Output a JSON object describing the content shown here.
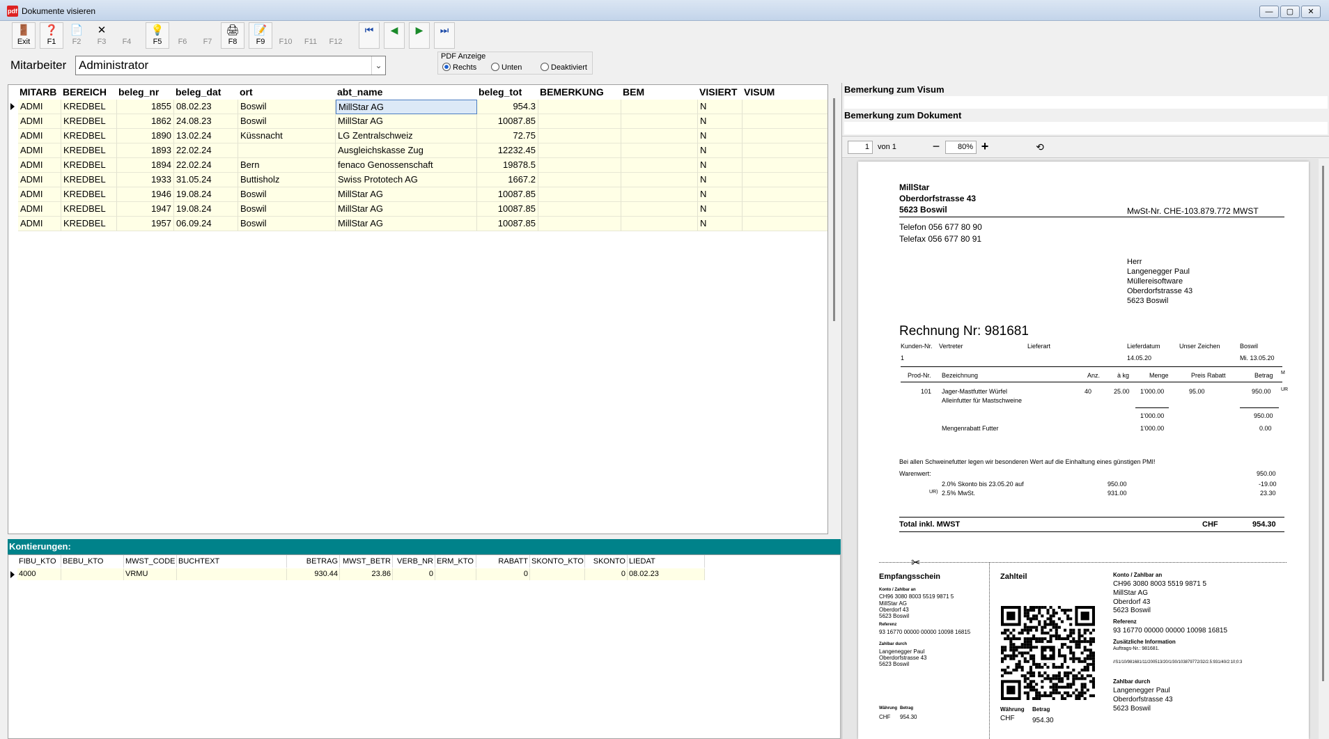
{
  "window": {
    "title": "Dokumente visieren",
    "app_icon": "pdf",
    "min": "—",
    "max": "▢",
    "close": "✕"
  },
  "toolbar": [
    {
      "label": "Exit",
      "icon": "exit-door-icon",
      "glyph": "🚪",
      "enabled": true
    },
    {
      "label": "F1",
      "icon": "help-icon",
      "glyph": "❓",
      "enabled": true
    },
    {
      "label": "F2",
      "icon": "new-document-icon",
      "glyph": "📄",
      "enabled": false
    },
    {
      "label": "F3",
      "icon": "delete-icon",
      "glyph": "✕",
      "enabled": false
    },
    {
      "label": "F4",
      "icon": "",
      "glyph": "",
      "enabled": false
    },
    {
      "label": "F5",
      "icon": "lightbulb-icon",
      "glyph": "💡",
      "enabled": true
    },
    {
      "label": "F6",
      "icon": "",
      "glyph": "",
      "enabled": false
    },
    {
      "label": "F7",
      "icon": "",
      "glyph": "",
      "enabled": false
    },
    {
      "label": "F8",
      "icon": "print-icon",
      "glyph": "🖨",
      "enabled": true
    },
    {
      "label": "F9",
      "icon": "edit-icon",
      "glyph": "📝",
      "enabled": true
    },
    {
      "label": "F10",
      "icon": "",
      "glyph": "",
      "enabled": false
    },
    {
      "label": "F11",
      "icon": "",
      "glyph": "",
      "enabled": false
    },
    {
      "label": "F12",
      "icon": "",
      "glyph": "",
      "enabled": false
    }
  ],
  "nav_buttons": [
    {
      "icon": "first-record-icon",
      "glyph": "⏮",
      "color": "#1b4aa8"
    },
    {
      "icon": "previous-record-icon",
      "glyph": "◀",
      "color": "#1a8a2a"
    },
    {
      "icon": "next-record-icon",
      "glyph": "▶",
      "color": "#1a8a2a"
    },
    {
      "icon": "last-record-icon",
      "glyph": "⏭",
      "color": "#1b4aa8"
    }
  ],
  "filter": {
    "label": "Mitarbeiter",
    "value": "Administrator",
    "arrow": "⌄"
  },
  "pdf_display": {
    "legend": "PDF Anzeige",
    "options": [
      "Rechts",
      "Unten",
      "Deaktiviert"
    ],
    "selected": "Rechts"
  },
  "grid": {
    "columns": [
      "MITARB",
      "BEREICH",
      "beleg_nr",
      "beleg_dat",
      "ort",
      "abt_name",
      "beleg_tot",
      "BEMERKUNG",
      "BEM",
      "VISIERT",
      "VISUM"
    ],
    "rows": [
      [
        "ADMI",
        "KREDBEL",
        "1855",
        "08.02.23",
        "Boswil",
        "MillStar AG",
        "954.3",
        "",
        "",
        "N",
        ""
      ],
      [
        "ADMI",
        "KREDBEL",
        "1862",
        "24.08.23",
        "Boswil",
        "MillStar AG",
        "10087.85",
        "",
        "",
        "N",
        ""
      ],
      [
        "ADMI",
        "KREDBEL",
        "1890",
        "13.02.24",
        "Küssnacht",
        "LG Zentralschweiz",
        "72.75",
        "",
        "",
        "N",
        ""
      ],
      [
        "ADMI",
        "KREDBEL",
        "1893",
        "22.02.24",
        "",
        "Ausgleichskasse Zug",
        "12232.45",
        "",
        "",
        "N",
        ""
      ],
      [
        "ADMI",
        "KREDBEL",
        "1894",
        "22.02.24",
        "Bern",
        "fenaco Genossenschaft",
        "19878.5",
        "",
        "",
        "N",
        ""
      ],
      [
        "ADMI",
        "KREDBEL",
        "1933",
        "31.05.24",
        "Buttisholz",
        "Swiss Prototech AG",
        "1667.2",
        "",
        "",
        "N",
        ""
      ],
      [
        "ADMI",
        "KREDBEL",
        "1946",
        "19.08.24",
        "Boswil",
        "MillStar AG",
        "10087.85",
        "",
        "",
        "N",
        ""
      ],
      [
        "ADMI",
        "KREDBEL",
        "1947",
        "19.08.24",
        "Boswil",
        "MillStar AG",
        "10087.85",
        "",
        "",
        "N",
        ""
      ],
      [
        "ADMI",
        "KREDBEL",
        "1957",
        "06.09.24",
        "Boswil",
        "MillStar AG",
        "10087.85",
        "",
        "",
        "N",
        ""
      ]
    ]
  },
  "kontierungen": {
    "label": "Kontierungen:",
    "columns": [
      "FIBU_KTO",
      "BEBU_KTO",
      "MWST_CODE",
      "BUCHTEXT",
      "BETRAG",
      "MWST_BETR",
      "VERB_NR",
      "ERM_KTO",
      "RABATT",
      "SKONTO_KTO",
      "SKONTO",
      "LIEDAT"
    ],
    "rows": [
      [
        "4000",
        "",
        "VRMU",
        "",
        "930.44",
        "23.86",
        "0",
        "",
        "0",
        "",
        "0",
        "08.02.23"
      ]
    ]
  },
  "right": {
    "bem_visum": "Bemerkung zum Visum",
    "bem_dokument": "Bemerkung zum Dokument"
  },
  "pdf_toolbar": {
    "page": "1",
    "of": "von 1",
    "zoom": "80%",
    "minus": "−",
    "plus": "+",
    "rotate": "⟲"
  },
  "invoice": {
    "sender": [
      "MillStar",
      "Oberdorfstrasse 43",
      "5623  Boswil"
    ],
    "vat": "MwSt-Nr. CHE-103.879.772 MWST",
    "tel": "Telefon  056 677 80 90",
    "fax": "Telefax  056 677 80 91",
    "recipient": [
      "Herr",
      "Langenegger Paul",
      "Müllereisoftware",
      "Oberdorfstrasse 43",
      "5623 Boswil"
    ],
    "title": "Rechnung Nr: 981681",
    "meta_headers": [
      "Kunden-Nr.",
      "Vertreter",
      "Lieferart",
      "Lieferdatum",
      "Unser Zeichen",
      "Boswil"
    ],
    "meta_values": [
      "1",
      "14.05.20",
      "Mi. 13.05.20"
    ],
    "item_headers": [
      "Prod-Nr.",
      "Bezeichnung",
      "Anz.",
      "à kg",
      "Menge",
      "Preis",
      "Rabatt",
      "Betrag",
      "M"
    ],
    "item": {
      "nr": "101",
      "name": "Jager-Mastfutter Würfel",
      "desc": "Alleinfutter für Mastschweine",
      "anz": "40",
      "kg": "25.00",
      "menge": "1'000.00",
      "preis": "95.00",
      "betrag": "950.00",
      "m": "UR"
    },
    "sub_menge": "1'000.00",
    "sub_betrag": "950.00",
    "rabatt_label": "Mengenrabatt Futter",
    "rabatt_menge": "1'000.00",
    "rabatt_betrag": "0.00",
    "note": "Bei allen Schweinefutter legen wir besonderen Wert auf die Einhaltung eines günstigen PMI!",
    "warenwert_label": "Warenwert:",
    "warenwert": "950.00",
    "skonto_label": "2.0% Skonto bis 23.05.20 auf",
    "skonto_base": "950.00",
    "skonto": "-19.00",
    "mwst_code": "UR)",
    "mwst_label": "2.5% MwSt.",
    "mwst_base": "931.00",
    "mwst": "23.30",
    "total_label": "Total inkl. MWST",
    "total_cur": "CHF",
    "total": "954.30"
  },
  "qr_bill": {
    "receipt_title": "Empfangsschein",
    "konto_label": "Konto / Zahlbar an",
    "konto": [
      "CH96 3080 8003 5519 9871 5",
      "MillStar AG",
      "Oberdorf 43",
      "5623 Boswil"
    ],
    "referenz_label": "Referenz",
    "referenz": "93 16770 00000 00000 10098 16815",
    "zahlbar_label": "Zahlbar durch",
    "zahlbar": [
      "Langenegger Paul",
      "Oberdorfstrasse 43",
      "5623 Boswil"
    ],
    "waehrung_label": "Währung",
    "betrag_label": "Betrag",
    "waehrung": "CHF",
    "betrag": "954.30",
    "payment_title": "Zahlteil",
    "konto_right": [
      "CH96 3080 8003 5519 9871 5",
      "MillStar AG",
      "Oberdorf 43",
      "5623 Boswil"
    ],
    "zus_label": "Zusätzliche Information",
    "zus": "Auftrags-Nr.: 981681.",
    "zus_code": "//S1/10/981681/11/200513/20/1/30/103879772/32/2.5:931/40/2:10;0:3",
    "scissors": "✂"
  }
}
